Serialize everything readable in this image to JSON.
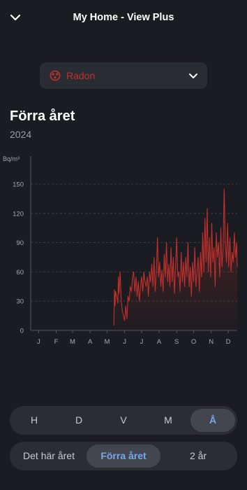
{
  "header": {
    "title": "My Home - View Plus"
  },
  "sensor_selector": {
    "label": "Radon",
    "icon": "radon-icon",
    "color": "#c0302c"
  },
  "period": {
    "title": "Förra året",
    "year": "2024"
  },
  "chart_data": {
    "type": "area",
    "unit_label": "Bq/m³",
    "ylim": [
      0,
      150
    ],
    "yticks": [
      "0",
      "30",
      "60",
      "90",
      "120",
      "150"
    ],
    "xticks": [
      "J",
      "F",
      "M",
      "A",
      "M",
      "J",
      "J",
      "A",
      "S",
      "O",
      "N",
      "D"
    ],
    "x_range": [
      "2024-01-01",
      "2024-12-31"
    ],
    "grid": true,
    "series": [
      {
        "color": "#c0302c",
        "points": [
          [
            "2024-05-27",
            5
          ],
          [
            "2024-05-28",
            42
          ],
          [
            "2024-05-29",
            25
          ],
          [
            "2024-05-30",
            40
          ],
          [
            "2024-06-01",
            35
          ],
          [
            "2024-06-03",
            28
          ],
          [
            "2024-06-04",
            55
          ],
          [
            "2024-06-05",
            38
          ],
          [
            "2024-06-07",
            60
          ],
          [
            "2024-06-09",
            30
          ],
          [
            "2024-06-11",
            20
          ],
          [
            "2024-06-13",
            15
          ],
          [
            "2024-06-15",
            10
          ],
          [
            "2024-06-17",
            25
          ],
          [
            "2024-06-19",
            12
          ],
          [
            "2024-06-21",
            35
          ],
          [
            "2024-06-23",
            30
          ],
          [
            "2024-06-25",
            45
          ],
          [
            "2024-06-27",
            40
          ],
          [
            "2024-06-29",
            55
          ],
          [
            "2024-07-01",
            60
          ],
          [
            "2024-07-03",
            40
          ],
          [
            "2024-07-05",
            55
          ],
          [
            "2024-07-07",
            35
          ],
          [
            "2024-07-09",
            50
          ],
          [
            "2024-07-11",
            30
          ],
          [
            "2024-07-13",
            45
          ],
          [
            "2024-07-15",
            55
          ],
          [
            "2024-07-17",
            40
          ],
          [
            "2024-07-19",
            60
          ],
          [
            "2024-07-21",
            50
          ],
          [
            "2024-07-23",
            45
          ],
          [
            "2024-07-25",
            55
          ],
          [
            "2024-07-27",
            35
          ],
          [
            "2024-07-29",
            60
          ],
          [
            "2024-07-31",
            50
          ],
          [
            "2024-08-02",
            68
          ],
          [
            "2024-08-04",
            45
          ],
          [
            "2024-08-06",
            75
          ],
          [
            "2024-08-08",
            40
          ],
          [
            "2024-08-10",
            60
          ],
          [
            "2024-08-12",
            95
          ],
          [
            "2024-08-14",
            55
          ],
          [
            "2024-08-16",
            70
          ],
          [
            "2024-08-18",
            45
          ],
          [
            "2024-08-20",
            62
          ],
          [
            "2024-08-22",
            40
          ],
          [
            "2024-08-24",
            78
          ],
          [
            "2024-08-26",
            55
          ],
          [
            "2024-08-28",
            90
          ],
          [
            "2024-08-30",
            50
          ],
          [
            "2024-09-01",
            68
          ],
          [
            "2024-09-03",
            45
          ],
          [
            "2024-09-05",
            85
          ],
          [
            "2024-09-07",
            50
          ],
          [
            "2024-09-09",
            75
          ],
          [
            "2024-09-11",
            38
          ],
          [
            "2024-09-13",
            65
          ],
          [
            "2024-09-15",
            95
          ],
          [
            "2024-09-17",
            55
          ],
          [
            "2024-09-19",
            60
          ],
          [
            "2024-09-21",
            40
          ],
          [
            "2024-09-23",
            80
          ],
          [
            "2024-09-25",
            50
          ],
          [
            "2024-09-27",
            70
          ],
          [
            "2024-09-29",
            45
          ],
          [
            "2024-10-01",
            75
          ],
          [
            "2024-10-03",
            55
          ],
          [
            "2024-10-05",
            90
          ],
          [
            "2024-10-07",
            45
          ],
          [
            "2024-10-09",
            65
          ],
          [
            "2024-10-11",
            35
          ],
          [
            "2024-10-13",
            70
          ],
          [
            "2024-10-15",
            50
          ],
          [
            "2024-10-17",
            85
          ],
          [
            "2024-10-19",
            45
          ],
          [
            "2024-10-21",
            60
          ],
          [
            "2024-10-23",
            75
          ],
          [
            "2024-10-25",
            40
          ],
          [
            "2024-10-27",
            80
          ],
          [
            "2024-10-29",
            55
          ],
          [
            "2024-10-31",
            100
          ],
          [
            "2024-11-02",
            60
          ],
          [
            "2024-11-04",
            115
          ],
          [
            "2024-11-06",
            70
          ],
          [
            "2024-11-08",
            125
          ],
          [
            "2024-11-10",
            60
          ],
          [
            "2024-11-12",
            95
          ],
          [
            "2024-11-14",
            55
          ],
          [
            "2024-11-16",
            110
          ],
          [
            "2024-11-18",
            70
          ],
          [
            "2024-11-20",
            85
          ],
          [
            "2024-11-22",
            45
          ],
          [
            "2024-11-24",
            100
          ],
          [
            "2024-11-26",
            75
          ],
          [
            "2024-11-28",
            90
          ],
          [
            "2024-11-30",
            55
          ],
          [
            "2024-12-02",
            105
          ],
          [
            "2024-12-04",
            65
          ],
          [
            "2024-12-06",
            85
          ],
          [
            "2024-12-08",
            145
          ],
          [
            "2024-12-10",
            90
          ],
          [
            "2024-12-12",
            70
          ],
          [
            "2024-12-14",
            110
          ],
          [
            "2024-12-16",
            65
          ],
          [
            "2024-12-18",
            95
          ],
          [
            "2024-12-20",
            60
          ],
          [
            "2024-12-22",
            80
          ],
          [
            "2024-12-24",
            70
          ],
          [
            "2024-12-26",
            100
          ],
          [
            "2024-12-28",
            75
          ],
          [
            "2024-12-30",
            90
          ],
          [
            "2024-12-31",
            65
          ]
        ]
      }
    ]
  },
  "resolution_tabs": [
    {
      "label": "H",
      "active": false
    },
    {
      "label": "D",
      "active": false
    },
    {
      "label": "V",
      "active": false
    },
    {
      "label": "M",
      "active": false
    },
    {
      "label": "Å",
      "active": true
    }
  ],
  "range_tabs": [
    {
      "label": "Det här året",
      "active": false
    },
    {
      "label": "Förra året",
      "active": true
    },
    {
      "label": "2 år",
      "active": false
    }
  ],
  "colors": {
    "background": "#1b1c21",
    "accent": "#7aa6ee",
    "radon": "#c0302c"
  }
}
